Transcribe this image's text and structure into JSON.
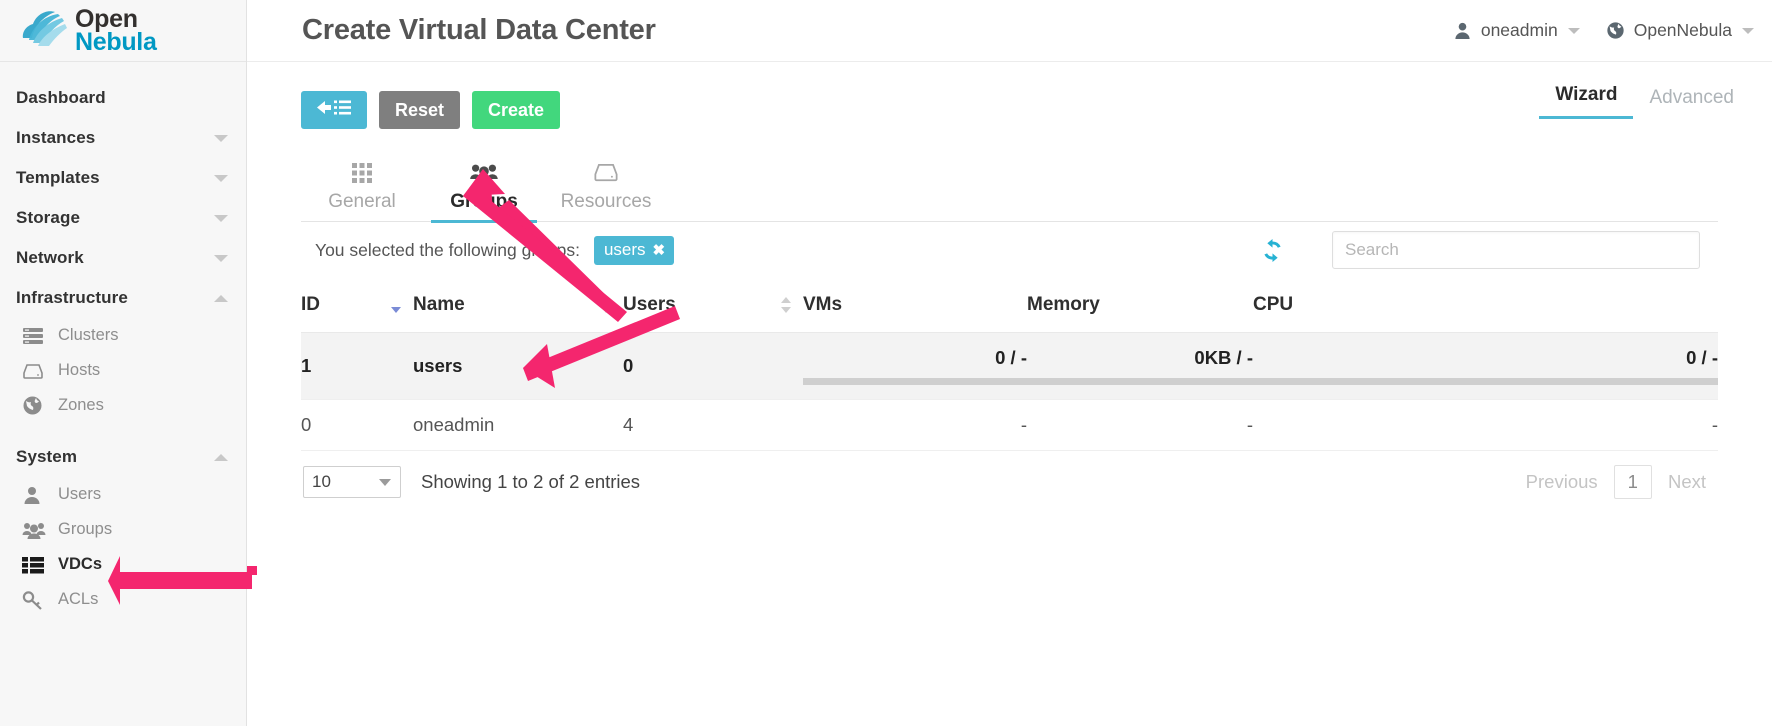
{
  "brand": {
    "line1": "Open",
    "line2": "Nebula",
    "logo_icon": "opennebula-cloud-logo",
    "accent": "#0098c3"
  },
  "sidebar": {
    "groups": [
      {
        "label": "Dashboard",
        "type": "link",
        "icon": null
      },
      {
        "label": "Instances",
        "type": "collapsible",
        "state": "collapsed",
        "icon": "chevron-down-icon"
      },
      {
        "label": "Templates",
        "type": "collapsible",
        "state": "collapsed",
        "icon": "chevron-down-icon"
      },
      {
        "label": "Storage",
        "type": "collapsible",
        "state": "collapsed",
        "icon": "chevron-down-icon"
      },
      {
        "label": "Network",
        "type": "collapsible",
        "state": "collapsed",
        "icon": "chevron-down-icon"
      },
      {
        "label": "Infrastructure",
        "type": "collapsible",
        "state": "expanded",
        "icon": "chevron-up-icon"
      }
    ],
    "infrastructure_items": [
      {
        "label": "Clusters",
        "icon": "servers-icon",
        "active": false
      },
      {
        "label": "Hosts",
        "icon": "hard-drive-icon",
        "active": false
      },
      {
        "label": "Zones",
        "icon": "globe-icon",
        "active": false
      }
    ],
    "system_header": {
      "label": "System",
      "state": "expanded",
      "icon": "chevron-up-icon"
    },
    "system_items": [
      {
        "label": "Users",
        "icon": "user-icon",
        "active": false
      },
      {
        "label": "Groups",
        "icon": "users-group-icon",
        "active": false
      },
      {
        "label": "VDCs",
        "icon": "vdc-list-icon",
        "active": true
      },
      {
        "label": "ACLs",
        "icon": "key-icon",
        "active": false
      }
    ]
  },
  "header": {
    "title": "Create Virtual Data Center",
    "user": {
      "label": "oneadmin",
      "icon": "user-icon",
      "caret": "chevron-down-icon"
    },
    "zone": {
      "label": "OpenNebula",
      "icon": "globe-icon",
      "caret": "chevron-down-icon"
    }
  },
  "toolbar": {
    "back_label": "",
    "back_icon": "arrow-left-list-icon",
    "reset_label": "Reset",
    "create_label": "Create",
    "colors": {
      "back": "#4cb8d4",
      "reset": "#7f7f7f",
      "create": "#42d77d"
    }
  },
  "wizard_tabs": [
    {
      "label": "Wizard",
      "active": true
    },
    {
      "label": "Advanced",
      "active": false
    }
  ],
  "inner_tabs": [
    {
      "label": "General",
      "icon": "grid-icon",
      "active": false
    },
    {
      "label": "Groups",
      "icon": "users-group-icon",
      "active": true
    },
    {
      "label": "Resources",
      "icon": "hard-drive-icon",
      "active": false
    }
  ],
  "selection": {
    "label": "You selected the following groups:",
    "chips": [
      {
        "label": "users",
        "remove_icon": "close-icon"
      }
    ]
  },
  "search": {
    "placeholder": "Search",
    "value": ""
  },
  "refresh": {
    "icon": "refresh-icon",
    "color": "#27b2d3"
  },
  "table": {
    "columns": [
      {
        "key": "id",
        "label": "ID",
        "sortable": true,
        "sort": "desc"
      },
      {
        "key": "name",
        "label": "Name",
        "sortable": true,
        "sort": "none"
      },
      {
        "key": "users",
        "label": "Users",
        "sortable": true,
        "sort": "none"
      },
      {
        "key": "vms",
        "label": "VMs",
        "sortable": false,
        "sort": "none"
      },
      {
        "key": "memory",
        "label": "Memory",
        "sortable": false,
        "sort": "none"
      },
      {
        "key": "cpu",
        "label": "CPU",
        "sortable": false,
        "sort": "none"
      }
    ],
    "rows": [
      {
        "id": "1",
        "name": "users",
        "users": "0",
        "vms": "0 / -",
        "memory": "0KB / -",
        "cpu": "0 / -",
        "has_bars": true,
        "selected": true
      },
      {
        "id": "0",
        "name": "oneadmin",
        "users": "4",
        "vms": "-",
        "memory": "-",
        "cpu": "-",
        "has_bars": false,
        "selected": false
      }
    ]
  },
  "footer": {
    "page_size": "10",
    "showing": "Showing 1 to 2 of 2 entries",
    "previous": "Previous",
    "page": "1",
    "next": "Next"
  },
  "annotations": {
    "color": "#f4266e",
    "arrows": [
      {
        "name": "arrow-to-groups-tab"
      },
      {
        "name": "arrow-to-users-row"
      },
      {
        "name": "arrow-to-vdcs-sidebar"
      }
    ]
  }
}
